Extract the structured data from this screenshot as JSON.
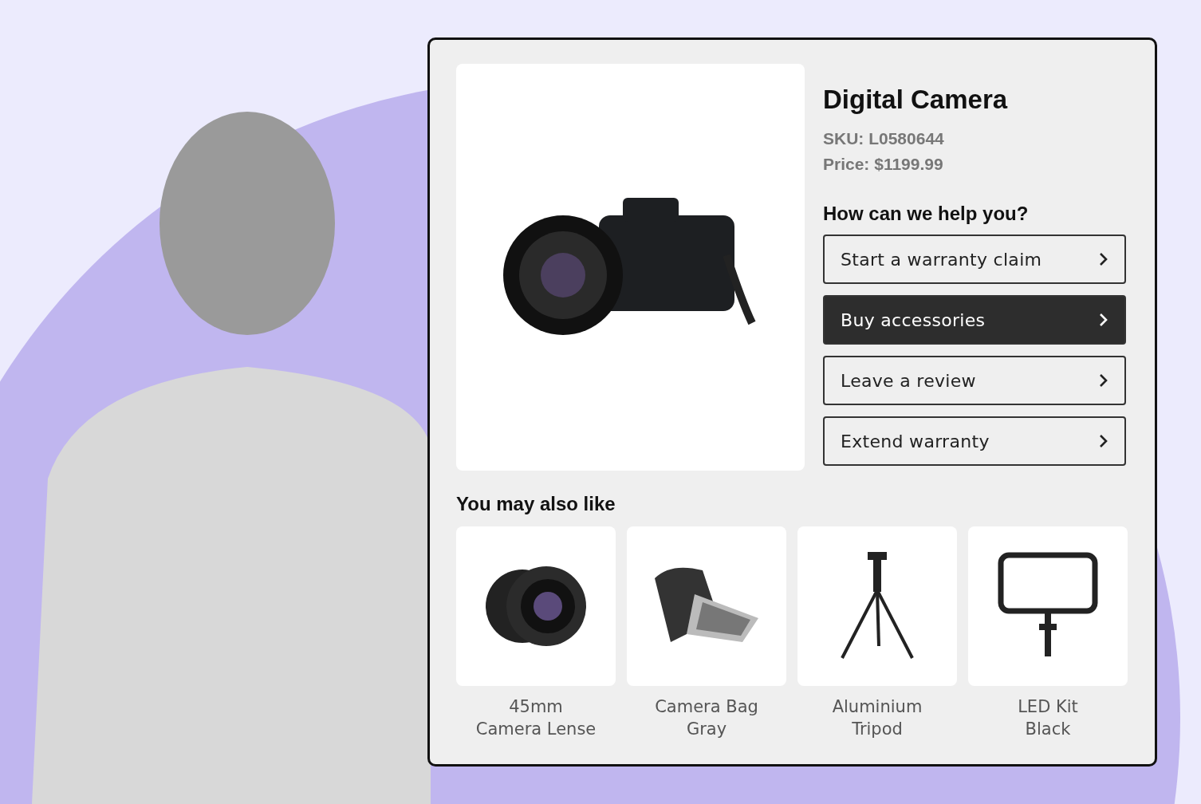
{
  "product": {
    "title": "Digital Camera",
    "sku": "SKU: L0580644",
    "price": "Price: $1199.99"
  },
  "help": {
    "heading": "How can we help you?",
    "actions": [
      {
        "label": "Start a warranty claim",
        "selected": false
      },
      {
        "label": "Buy accessories",
        "selected": true
      },
      {
        "label": "Leave a review",
        "selected": false
      },
      {
        "label": "Extend warranty",
        "selected": false
      }
    ]
  },
  "recommendations": {
    "heading": "You may also like",
    "items": [
      {
        "kind": "lens",
        "name": "45mm\nCamera Lense"
      },
      {
        "kind": "bag",
        "name": "Camera Bag\nGray"
      },
      {
        "kind": "tripod",
        "name": "Aluminium\nTripod"
      },
      {
        "kind": "light",
        "name": "LED Kit\nBlack"
      }
    ]
  }
}
